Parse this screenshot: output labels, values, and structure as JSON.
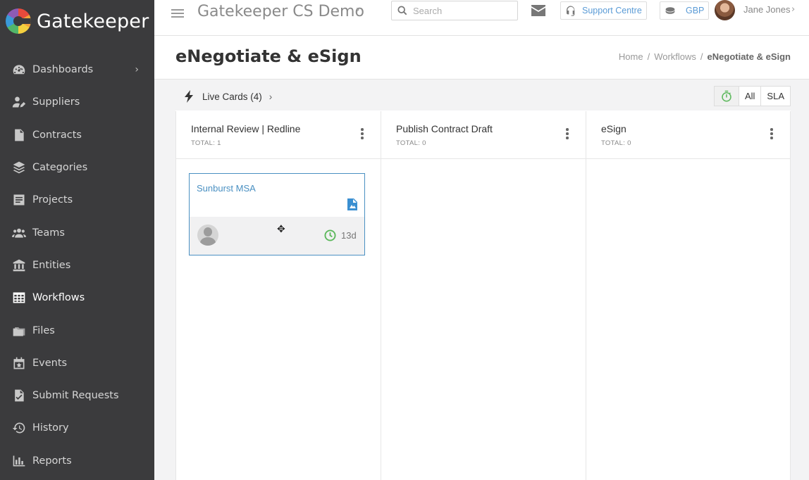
{
  "app": {
    "logo_text": "Gatekeeper",
    "org_title": "Gatekeeper CS Demo"
  },
  "sidebar": {
    "items": [
      {
        "label": "Dashboards",
        "icon": "dashboard-icon",
        "has_chevron": true
      },
      {
        "label": "Suppliers",
        "icon": "suppliers-icon"
      },
      {
        "label": "Contracts",
        "icon": "contracts-icon"
      },
      {
        "label": "Categories",
        "icon": "layers-icon"
      },
      {
        "label": "Projects",
        "icon": "projects-icon"
      },
      {
        "label": "Teams",
        "icon": "teams-icon"
      },
      {
        "label": "Entities",
        "icon": "bank-icon"
      },
      {
        "label": "Workflows",
        "icon": "table-icon",
        "active": true
      },
      {
        "label": "Files",
        "icon": "folder-icon"
      },
      {
        "label": "Events",
        "icon": "calendar-icon"
      },
      {
        "label": "Submit Requests",
        "icon": "check-doc-icon"
      },
      {
        "label": "History",
        "icon": "history-icon"
      },
      {
        "label": "Reports",
        "icon": "bar-chart-icon"
      }
    ]
  },
  "topbar": {
    "search_placeholder": "Search",
    "support_label": "Support Centre",
    "currency_label": "GBP",
    "user_name": "Jane Jones"
  },
  "page": {
    "title": "eNegotiate & eSign",
    "breadcrumb": {
      "home": "Home",
      "workflows": "Workflows",
      "current": "eNegotiate & eSign"
    }
  },
  "board": {
    "live_label": "Live Cards (4)",
    "filter_all": "All",
    "filter_sla": "SLA",
    "columns": [
      {
        "title": "Internal Review | Redline",
        "total": "TOTAL: 1"
      },
      {
        "title": "Publish Contract Draft",
        "total": "TOTAL: 0"
      },
      {
        "title": "eSign",
        "total": "TOTAL: 0"
      }
    ],
    "card": {
      "title": "Sunburst MSA",
      "days": "13d"
    }
  },
  "colors": {
    "sidebar_bg": "#3b3b3d",
    "accent_blue": "#4a90c2",
    "sla_green": "#5cb85c"
  }
}
